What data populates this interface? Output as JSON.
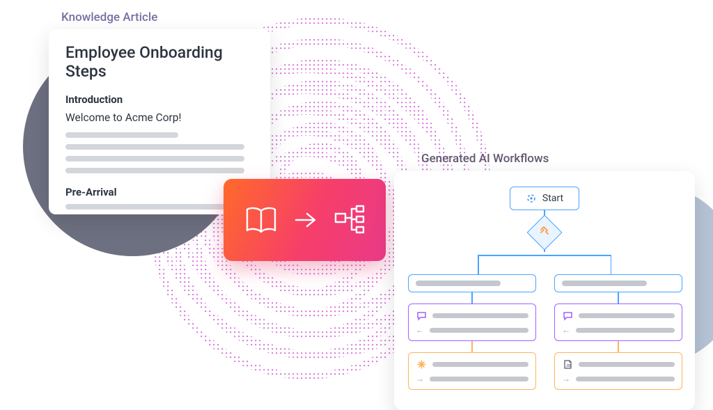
{
  "labels": {
    "article": "Knowledge Article",
    "workflow": "Generated AI Workflows"
  },
  "article": {
    "title": "Employee Onboarding Steps",
    "section1_heading": "Introduction",
    "welcome_text": "Welcome to Acme Corp!",
    "section2_heading": "Pre-Arrival"
  },
  "workflow": {
    "start_label": "Start"
  },
  "icons": {
    "book": "book-icon",
    "arrow_right": "arrow-right-icon",
    "flowchart": "flowchart-icon",
    "start_target": "target-icon",
    "decision": "hammer-icon",
    "chat": "chat-icon",
    "sparkle": "sparkle-icon",
    "script": "script-icon"
  },
  "colors": {
    "accent_blue": "#4aa3ff",
    "accent_purple": "#a261ff",
    "accent_orange": "#ffb25a",
    "badge_gradient_from": "#ff6a2a",
    "badge_gradient_to": "#e93a88",
    "label_purple": "#7b6fa3"
  }
}
